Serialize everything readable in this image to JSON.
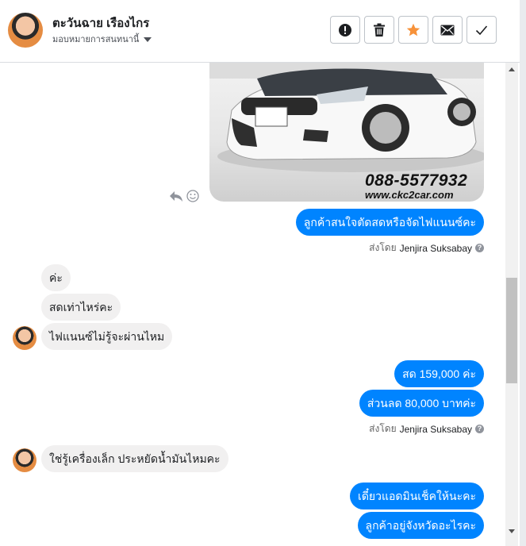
{
  "header": {
    "name": "ตะวันฉาย เรืองไกร",
    "subtitle": "มอบหมายการสนทนานี้"
  },
  "toolbar": {
    "buttons": [
      {
        "icon": "alert-icon"
      },
      {
        "icon": "trash-icon"
      },
      {
        "icon": "star-icon",
        "color": "#f7923a"
      },
      {
        "icon": "mail-icon"
      },
      {
        "icon": "check-icon"
      }
    ]
  },
  "image": {
    "phone": "088-5577932",
    "site": "www.ckc2car.com"
  },
  "messages": {
    "out1": "ลูกค้าสนใจตัดสดหรือจัดไฟแนนซ์คะ",
    "sent_by_label": "ส่งโดย",
    "sent_by_name": "Jenjira Suksabay",
    "in1": "ค่ะ",
    "in2": "สดเท่าไหร่คะ",
    "in3": "ไฟแนนซ์ไม่รู้จะผ่านไหม",
    "out2": "สด 159,000 ค่ะ",
    "out3": "ส่วนลด 80,000 บาทค่ะ",
    "sent_by_label_2": "ส่งโดย",
    "sent_by_name_2": "Jenjira Suksabay",
    "in4": "ใช่รู้เครื่องเล็ก ประหยัดน้ำมันไหมคะ",
    "out4": "เดี๋ยวแอดมินเช็คให้นะคะ",
    "out5": "ลูกค้าอยู่จังหวัดอะไรคะ"
  },
  "colors": {
    "outgoing_bubble": "#0084ff",
    "incoming_bubble": "#f1f0f0",
    "star": "#f7923a"
  }
}
